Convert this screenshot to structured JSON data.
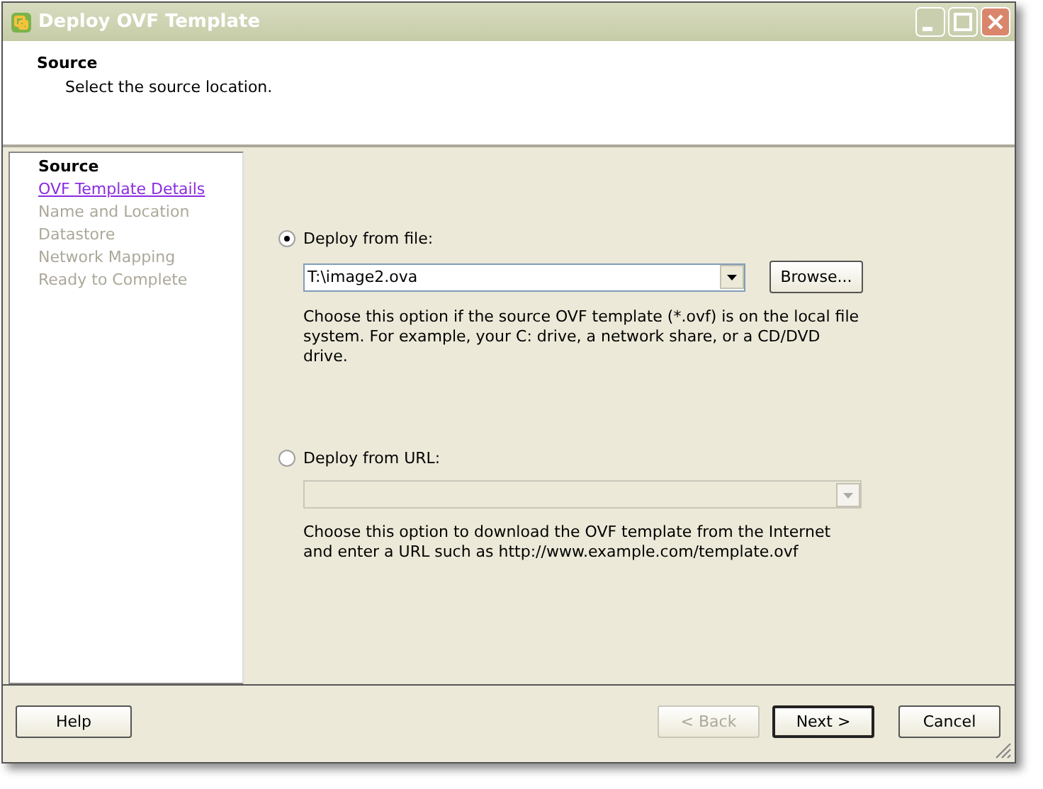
{
  "window": {
    "title": "Deploy OVF Template"
  },
  "header": {
    "title": "Source",
    "subtitle": "Select the source location."
  },
  "steps": [
    {
      "label": "Source",
      "kind": "current"
    },
    {
      "label": "OVF Template Details",
      "kind": "link"
    },
    {
      "label": "Name and Location",
      "kind": "pending"
    },
    {
      "label": "Datastore",
      "kind": "pending"
    },
    {
      "label": "Network Mapping",
      "kind": "pending"
    },
    {
      "label": "Ready to Complete",
      "kind": "pending"
    }
  ],
  "options": [
    {
      "label": "Deploy from file:",
      "selected": true,
      "value": "T:\\image2.ova",
      "disabled": false,
      "button": "Browse...",
      "description": "Choose this option if the source OVF template (*.ovf) is on the local file system. For example, your C: drive, a network share, or a CD/DVD drive."
    },
    {
      "label": "Deploy from URL:",
      "selected": false,
      "disabled": true,
      "description": "Choose this option to download the OVF template from the Internet and enter a URL such as http://www.example.com/template.ovf"
    }
  ],
  "footer": {
    "help": "Help",
    "buttons": [
      {
        "label": "< Back",
        "disabled": true,
        "default": false
      },
      {
        "label": "Next >",
        "disabled": false,
        "default": true
      },
      {
        "label": "Cancel",
        "disabled": false,
        "default": false
      }
    ]
  }
}
